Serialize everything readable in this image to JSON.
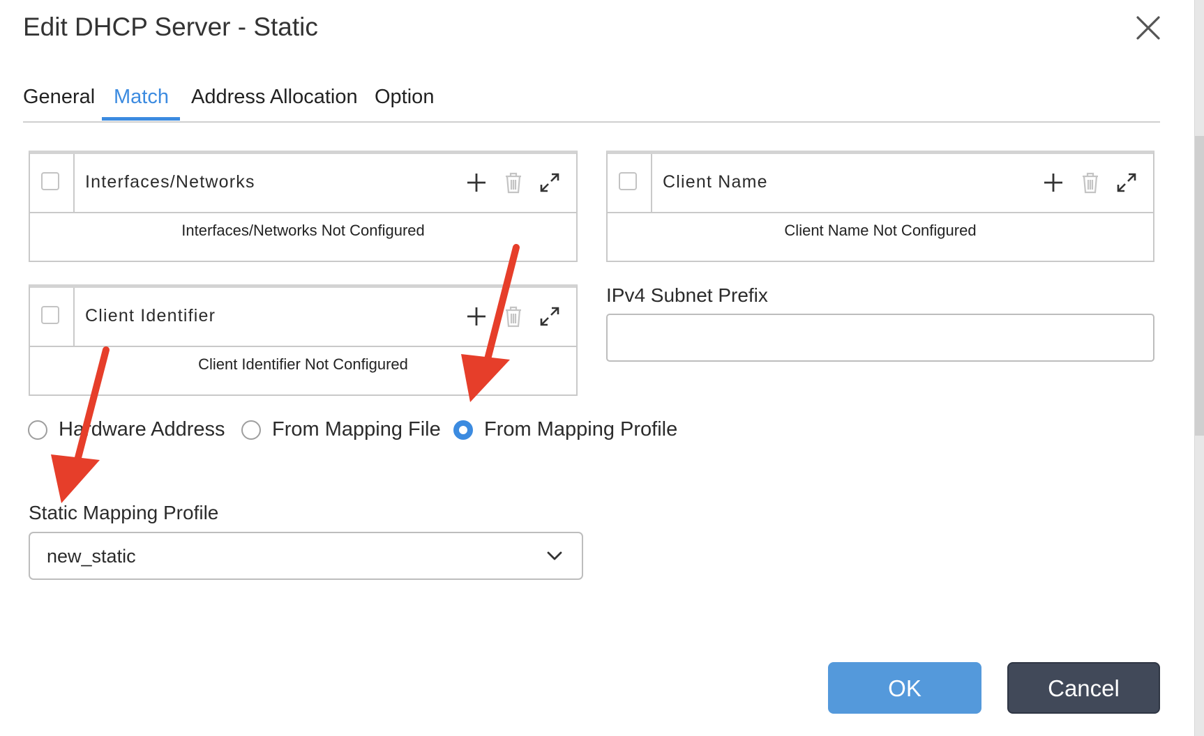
{
  "dialog": {
    "title": "Edit DHCP Server - Static",
    "close_icon": "close-icon"
  },
  "tabs": [
    {
      "label": "General",
      "active": false
    },
    {
      "label": "Match",
      "active": true
    },
    {
      "label": "Address Allocation",
      "active": false
    },
    {
      "label": "Option",
      "active": false
    }
  ],
  "panels": {
    "interfaces": {
      "title": "Interfaces/Networks",
      "empty_text": "Interfaces/Networks Not Configured"
    },
    "client_name": {
      "title": "Client Name",
      "empty_text": "Client Name Not Configured"
    },
    "client_identifier": {
      "title": "Client Identifier",
      "empty_text": "Client Identifier Not Configured"
    },
    "icons": [
      "plus-icon",
      "trash-icon",
      "expand-icon"
    ]
  },
  "ipv4_subnet_prefix": {
    "label": "IPv4 Subnet Prefix",
    "value": ""
  },
  "mapping_source": {
    "options": [
      {
        "label": "Hardware Address",
        "selected": false
      },
      {
        "label": "From Mapping File",
        "selected": false
      },
      {
        "label": "From Mapping Profile",
        "selected": true
      }
    ]
  },
  "static_mapping_profile": {
    "label": "Static Mapping Profile",
    "value": "new_static"
  },
  "buttons": {
    "ok": "OK",
    "cancel": "Cancel"
  },
  "colors": {
    "accent": "#3c8be0",
    "ok_button": "#5499db",
    "cancel_button": "#414959",
    "annotation_arrow": "#e63e2a"
  }
}
